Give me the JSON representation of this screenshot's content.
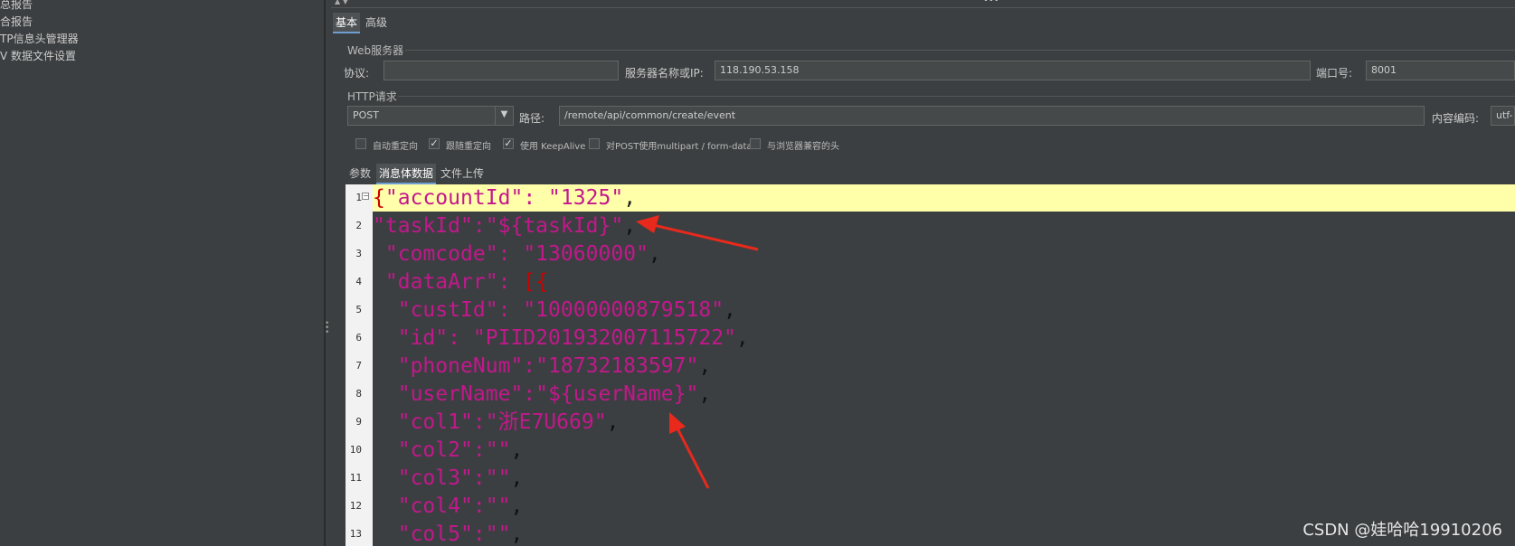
{
  "tree": {
    "items": [
      "总报告",
      "合报告",
      "TP信息头管理器",
      "V 数据文件设置"
    ]
  },
  "tabs": {
    "basic": "基本",
    "advanced": "高级"
  },
  "web_server": {
    "section_title": "Web服务器",
    "protocol_label": "协议:",
    "protocol_value": "",
    "server_label": "服务器名称或IP:",
    "server_value": "118.190.53.158",
    "port_label": "端口号:",
    "port_value": "8001"
  },
  "http_request": {
    "section_title": "HTTP请求",
    "method": "POST",
    "path_label": "路径:",
    "path_value": "/remote/api/common/create/event",
    "encoding_label": "内容编码:",
    "encoding_value": "utf-"
  },
  "options": [
    {
      "label": "自动重定向",
      "checked": false
    },
    {
      "label": "跟随重定向",
      "checked": true
    },
    {
      "label": "使用 KeepAlive",
      "checked": true
    },
    {
      "label": "对POST使用multipart / form-data",
      "checked": false
    },
    {
      "label": "与浏览器兼容的头",
      "checked": false
    }
  ],
  "body_tabs": {
    "params": "参数",
    "body_data": "消息体数据",
    "file_upload": "文件上传"
  },
  "editor": {
    "line_numbers": [
      "1",
      "2",
      "3",
      "4",
      "5",
      "6",
      "7",
      "8",
      "9",
      "10",
      "11",
      "12",
      "13"
    ],
    "lines": [
      "{\"accountId\": \"1325\",",
      "\"taskId\":\"${taskId}\",",
      " \"comcode\": \"13060000\",",
      " \"dataArr\": [{",
      "  \"custId\": \"10000000879518\",",
      "  \"id\": \"PIID201932007115722\",",
      "  \"phoneNum\":\"18732183597\",",
      "  \"userName\":\"${userName}\",",
      "  \"col1\":\"浙E7U669\",",
      "  \"col2\":\"\",",
      "  \"col3\":\"\",",
      "  \"col4\":\"\",",
      "  \"col5\":\"\","
    ]
  },
  "colors": {
    "accent_highlight": "#ffffaa",
    "string_color": "#c2188c",
    "annotation_arrow": "#e8291c"
  },
  "watermark": "CSDN @娃哈哈19910206"
}
